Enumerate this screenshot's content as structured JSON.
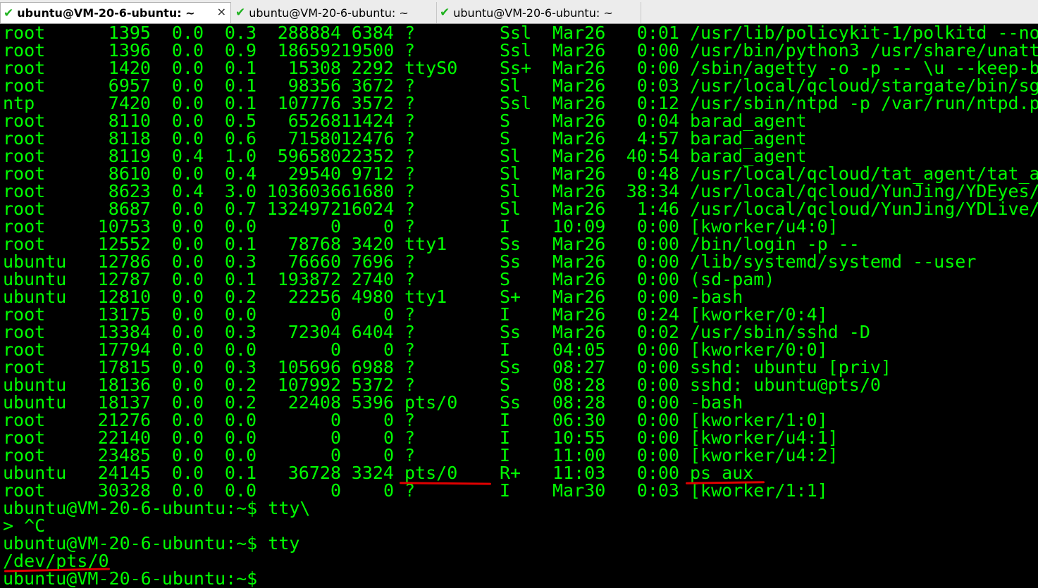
{
  "tabs": [
    {
      "label": "ubuntu@VM-20-6-ubuntu: ~",
      "active": true,
      "close": "×",
      "icon": "check-icon"
    },
    {
      "label": "ubuntu@VM-20-6-ubuntu: ~",
      "active": false,
      "icon": "check-icon"
    },
    {
      "label": "ubuntu@VM-20-6-ubuntu: ~",
      "active": false,
      "icon": "check-icon"
    }
  ],
  "terminal": {
    "text_color": "#00ff00",
    "background": "#000000",
    "ps_rows": [
      [
        "root",
        "1395",
        "0.0",
        "0.3",
        "288884",
        "6384",
        "?",
        "Ssl",
        "Mar26",
        "0:01",
        "/usr/lib/policykit-1/polkitd --no"
      ],
      [
        "root",
        "1396",
        "0.0",
        "0.9",
        "186592",
        "19500",
        "?",
        "Ssl",
        "Mar26",
        "0:00",
        "/usr/bin/python3 /usr/share/unatt"
      ],
      [
        "root",
        "1420",
        "0.0",
        "0.1",
        "15308",
        "2292",
        "ttyS0",
        "Ss+",
        "Mar26",
        "0:00",
        "/sbin/agetty -o -p -- \\u --keep-b"
      ],
      [
        "root",
        "6957",
        "0.0",
        "0.1",
        "98356",
        "3672",
        "?",
        "Sl",
        "Mar26",
        "0:03",
        "/usr/local/qcloud/stargate/bin/sg"
      ],
      [
        "ntp",
        "7420",
        "0.0",
        "0.1",
        "107776",
        "3572",
        "?",
        "Ssl",
        "Mar26",
        "0:12",
        "/usr/sbin/ntpd -p /var/run/ntpd.p"
      ],
      [
        "root",
        "8110",
        "0.0",
        "0.5",
        "65268",
        "11424",
        "?",
        "S",
        "Mar26",
        "0:04",
        "barad_agent"
      ],
      [
        "root",
        "8118",
        "0.0",
        "0.6",
        "71580",
        "12476",
        "?",
        "S",
        "Mar26",
        "4:57",
        "barad_agent"
      ],
      [
        "root",
        "8119",
        "0.4",
        "1.0",
        "596580",
        "22352",
        "?",
        "Sl",
        "Mar26",
        "40:54",
        "barad_agent"
      ],
      [
        "root",
        "8610",
        "0.0",
        "0.4",
        "29540",
        "9712",
        "?",
        "Sl",
        "Mar26",
        "0:48",
        "/usr/local/qcloud/tat_agent/tat_a"
      ],
      [
        "root",
        "8623",
        "0.4",
        "3.0",
        "1036036",
        "61680",
        "?",
        "Sl",
        "Mar26",
        "38:34",
        "/usr/local/qcloud/YunJing/YDEyes/"
      ],
      [
        "root",
        "8687",
        "0.0",
        "0.7",
        "1324972",
        "16024",
        "?",
        "Sl",
        "Mar26",
        "1:46",
        "/usr/local/qcloud/YunJing/YDLive/"
      ],
      [
        "root",
        "10753",
        "0.0",
        "0.0",
        "0",
        "0",
        "?",
        "I",
        "10:09",
        "0:00",
        "[kworker/u4:0]"
      ],
      [
        "root",
        "12552",
        "0.0",
        "0.1",
        "78768",
        "3420",
        "tty1",
        "Ss",
        "Mar26",
        "0:00",
        "/bin/login -p --"
      ],
      [
        "ubuntu",
        "12786",
        "0.0",
        "0.3",
        "76660",
        "7696",
        "?",
        "Ss",
        "Mar26",
        "0:00",
        "/lib/systemd/systemd --user"
      ],
      [
        "ubuntu",
        "12787",
        "0.0",
        "0.1",
        "193872",
        "2740",
        "?",
        "S",
        "Mar26",
        "0:00",
        "(sd-pam)"
      ],
      [
        "ubuntu",
        "12810",
        "0.0",
        "0.2",
        "22256",
        "4980",
        "tty1",
        "S+",
        "Mar26",
        "0:00",
        "-bash"
      ],
      [
        "root",
        "13175",
        "0.0",
        "0.0",
        "0",
        "0",
        "?",
        "I",
        "Mar26",
        "0:24",
        "[kworker/0:4]"
      ],
      [
        "root",
        "13384",
        "0.0",
        "0.3",
        "72304",
        "6404",
        "?",
        "Ss",
        "Mar26",
        "0:02",
        "/usr/sbin/sshd -D"
      ],
      [
        "root",
        "17794",
        "0.0",
        "0.0",
        "0",
        "0",
        "?",
        "I",
        "04:05",
        "0:00",
        "[kworker/0:0]"
      ],
      [
        "root",
        "17815",
        "0.0",
        "0.3",
        "105696",
        "6988",
        "?",
        "Ss",
        "08:27",
        "0:00",
        "sshd: ubuntu [priv]"
      ],
      [
        "ubuntu",
        "18136",
        "0.0",
        "0.2",
        "107992",
        "5372",
        "?",
        "S",
        "08:28",
        "0:00",
        "sshd: ubuntu@pts/0"
      ],
      [
        "ubuntu",
        "18137",
        "0.0",
        "0.2",
        "22408",
        "5396",
        "pts/0",
        "Ss",
        "08:28",
        "0:00",
        "-bash"
      ],
      [
        "root",
        "21276",
        "0.0",
        "0.0",
        "0",
        "0",
        "?",
        "I",
        "06:30",
        "0:00",
        "[kworker/1:0]"
      ],
      [
        "root",
        "22140",
        "0.0",
        "0.0",
        "0",
        "0",
        "?",
        "I",
        "10:55",
        "0:00",
        "[kworker/u4:1]"
      ],
      [
        "root",
        "23485",
        "0.0",
        "0.0",
        "0",
        "0",
        "?",
        "I",
        "11:00",
        "0:00",
        "[kworker/u4:2]"
      ],
      [
        "ubuntu",
        "24145",
        "0.0",
        "0.1",
        "36728",
        "3324",
        "pts/0",
        "R+",
        "11:03",
        "0:00",
        "ps aux"
      ],
      [
        "root",
        "30328",
        "0.0",
        "0.0",
        "0",
        "0",
        "?",
        "I",
        "Mar30",
        "0:03",
        "[kworker/1:1]"
      ]
    ],
    "tail_lines": [
      "ubuntu@VM-20-6-ubuntu:~$ tty\\",
      "> ^C",
      "ubuntu@VM-20-6-ubuntu:~$ tty",
      "/dev/pts/0",
      "ubuntu@VM-20-6-ubuntu:~$"
    ]
  },
  "annotations": {
    "underline_color": "#e00000"
  }
}
